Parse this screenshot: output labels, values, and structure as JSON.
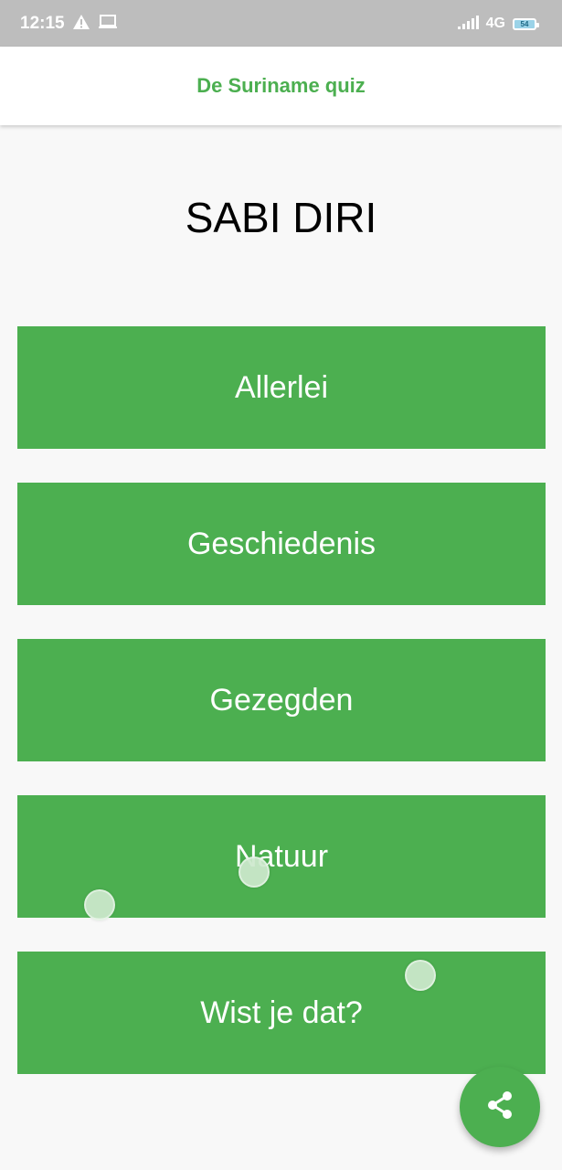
{
  "status_bar": {
    "time": "12:15",
    "network": "4G",
    "battery_level": "54",
    "icons": [
      "warning-icon",
      "laptop-icon",
      "signal-icon",
      "battery-icon"
    ]
  },
  "app_bar": {
    "title": "De Suriname quiz"
  },
  "page": {
    "heading": "SABI DIRI"
  },
  "categories": [
    {
      "label": "Allerlei"
    },
    {
      "label": "Geschiedenis"
    },
    {
      "label": "Gezegden"
    },
    {
      "label": "Natuur"
    },
    {
      "label": "Wist je dat?"
    }
  ],
  "fab": {
    "icon": "share-icon"
  },
  "colors": {
    "primary": "#4caf50",
    "status_bar": "#bdbdbd",
    "background": "#f8f8f8",
    "app_bar": "#ffffff"
  }
}
